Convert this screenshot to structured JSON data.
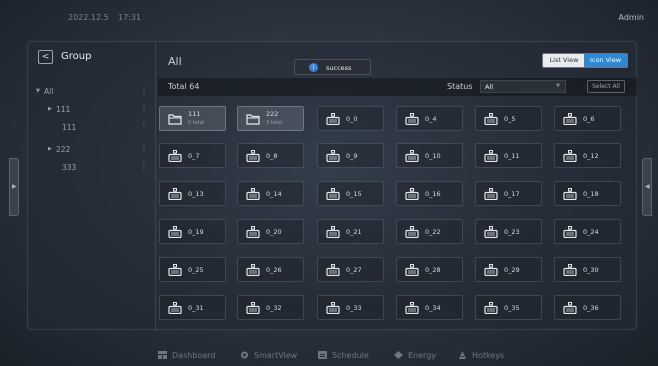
{
  "topbar": {
    "date": "2022.12.5",
    "time": "17:31",
    "user": "Admin"
  },
  "sidebar": {
    "back_icon": "chevron-left-icon",
    "title": "Group",
    "items": [
      {
        "label": "All",
        "expanded": true
      },
      {
        "label": "111",
        "expanded": false
      },
      {
        "label": "111"
      },
      {
        "label": "222",
        "expanded": false
      },
      {
        "label": "333"
      }
    ]
  },
  "main": {
    "title": "All",
    "view_list": "List View",
    "view_icon": "Icon View",
    "total": "Total 64",
    "status_label": "Status",
    "status_value": "All",
    "select_all": "Select All"
  },
  "toast": {
    "icon": "info-icon",
    "text": "success"
  },
  "tiles": [
    {
      "name": "111",
      "sub": "0 total",
      "type": "folder"
    },
    {
      "name": "222",
      "sub": "3 total",
      "type": "folder"
    },
    {
      "name": "0_0"
    },
    {
      "name": "0_4"
    },
    {
      "name": "0_5"
    },
    {
      "name": "0_6"
    },
    {
      "name": "0_7"
    },
    {
      "name": "0_8"
    },
    {
      "name": "0_9"
    },
    {
      "name": "0_10"
    },
    {
      "name": "0_11"
    },
    {
      "name": "0_12"
    },
    {
      "name": "0_13"
    },
    {
      "name": "0_14"
    },
    {
      "name": "0_15"
    },
    {
      "name": "0_16"
    },
    {
      "name": "0_17"
    },
    {
      "name": "0_18"
    },
    {
      "name": "0_19"
    },
    {
      "name": "0_20"
    },
    {
      "name": "0_21"
    },
    {
      "name": "0_22"
    },
    {
      "name": "0_23"
    },
    {
      "name": "0_24"
    },
    {
      "name": "0_25"
    },
    {
      "name": "0_26"
    },
    {
      "name": "0_27"
    },
    {
      "name": "0_28"
    },
    {
      "name": "0_29"
    },
    {
      "name": "0_30"
    },
    {
      "name": "0_31"
    },
    {
      "name": "0_32"
    },
    {
      "name": "0_33"
    },
    {
      "name": "0_34"
    },
    {
      "name": "0_35"
    },
    {
      "name": "0_36"
    }
  ],
  "nav": {
    "dashboard": "Dashboard",
    "smartview": "SmartView",
    "schedule": "Schedule",
    "energy": "Energy",
    "hotkeys": "Hotkeys"
  },
  "colors": {
    "accent": "#2d88d8",
    "toast_icon": "#3b82d6"
  }
}
